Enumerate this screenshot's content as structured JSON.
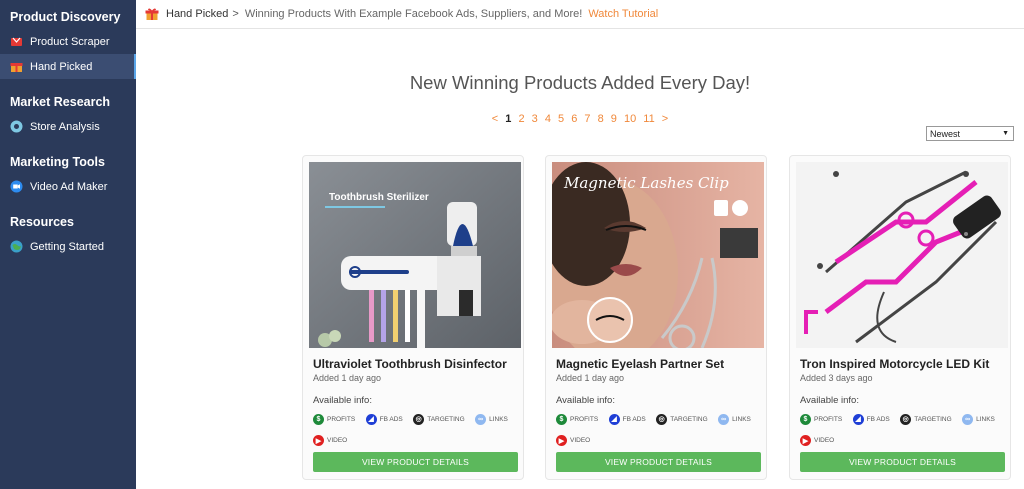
{
  "sidebar": {
    "sections": [
      {
        "title": "Product Discovery",
        "items": [
          {
            "label": "Product Scraper",
            "icon": "scraper-icon"
          },
          {
            "label": "Hand Picked",
            "icon": "gift-icon",
            "active": true
          }
        ]
      },
      {
        "title": "Market Research",
        "items": [
          {
            "label": "Store Analysis",
            "icon": "eye-icon"
          }
        ]
      },
      {
        "title": "Marketing Tools",
        "items": [
          {
            "label": "Video Ad Maker",
            "icon": "video-icon"
          }
        ]
      },
      {
        "title": "Resources",
        "items": [
          {
            "label": "Getting Started",
            "icon": "globe-icon"
          }
        ]
      }
    ]
  },
  "topbar": {
    "crumb": "Hand Picked",
    "separator": ">",
    "description": "Winning Products With Example Facebook Ads, Suppliers, and More!",
    "tutorial_link": "Watch Tutorial"
  },
  "headline": "New Winning Products Added Every Day!",
  "pagination": {
    "prev": "<",
    "next": ">",
    "current": "1",
    "pages": [
      "1",
      "2",
      "3",
      "4",
      "5",
      "6",
      "7",
      "8",
      "9",
      "10",
      "11"
    ]
  },
  "sort": {
    "selected": "Newest",
    "caret": "▼"
  },
  "available_label": "Available info:",
  "tags": {
    "profits": "PROFITS",
    "fb_ads": "FB ADS",
    "targeting": "TARGETING",
    "links": "LINKS",
    "video": "VIDEO"
  },
  "button_label": "VIEW PRODUCT DETAILS",
  "products": [
    {
      "title": "Ultraviolet Toothbrush Disinfector",
      "added": "Added 1 day ago",
      "image_text": "Toothbrush Sterilizer"
    },
    {
      "title": "Magnetic Eyelash Partner Set",
      "added": "Added 1 day ago",
      "image_text": "Magnetic Lashes Clip"
    },
    {
      "title": "Tron Inspired Motorcycle LED Kit",
      "added": "Added 3 days ago",
      "image_text": ""
    }
  ],
  "colors": {
    "sidebar_bg": "#2b3a5a",
    "accent_orange": "#f0883a",
    "button_green": "#5cb85c"
  }
}
